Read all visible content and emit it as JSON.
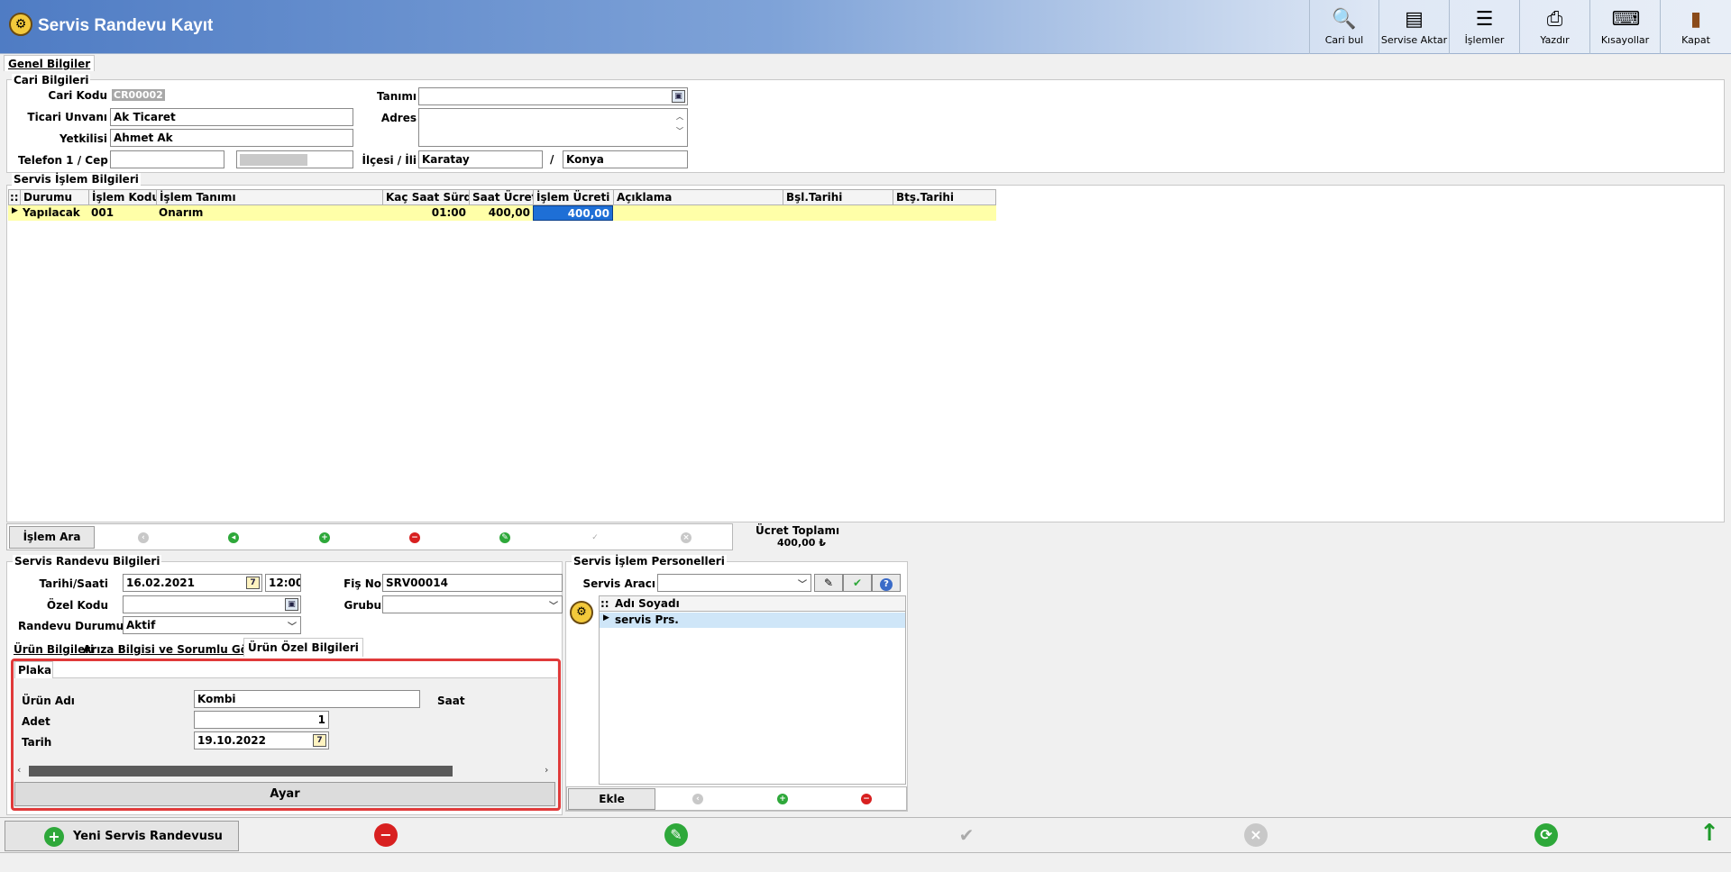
{
  "window": {
    "title": "Servis Randevu Kayıt"
  },
  "toolbar": {
    "buttons": [
      {
        "label": "Cari bul",
        "icon": "user-search-icon"
      },
      {
        "label": "Servise Aktar",
        "icon": "transfer-icon"
      },
      {
        "label": "İşlemler",
        "icon": "list-icon"
      },
      {
        "label": "Yazdır",
        "icon": "printer-icon"
      },
      {
        "label": "Kısayollar",
        "icon": "keyboard-icon"
      },
      {
        "label": "Kapat",
        "icon": "exit-door-icon"
      }
    ]
  },
  "tabs": {
    "main": "Genel Bilgiler"
  },
  "cari": {
    "title": "Cari Bilgileri",
    "cari_kodu_label": "Cari Kodu",
    "cari_kodu": "CR00002",
    "ticari_unvan_label": "Ticari Unvanı",
    "ticari_unvan": "Ak Ticaret",
    "yetkili_label": "Yetkilisi",
    "yetkili": "Ahmet Ak",
    "telefon_label": "Telefon 1 / Cep",
    "telefon": "",
    "cep": "",
    "tanimi_label": "Tanımı",
    "tanimi": "",
    "adres_label": "Adres",
    "adres": "",
    "ilce_label": "İlçesi / İli",
    "ilce": "Karatay",
    "sep": "/",
    "il": "Konya"
  },
  "islem": {
    "title": "Servis İşlem Bilgileri",
    "columns": {
      "handle": "::",
      "durum": "Durumu",
      "kod": "İşlem Kodu",
      "tanim": "İşlem Tanımı",
      "saat": "Kaç Saat Sürdü",
      "saat_ucreti": "Saat Ücreti",
      "islem_ucreti": "İşlem Ücreti",
      "aciklama": "Açıklama",
      "bsl": "Bşl.Tarihi",
      "bts": "Btş.Tarihi"
    },
    "rows": [
      {
        "durum": "Yapılacak",
        "kod": "001",
        "tanim": "Onarım",
        "saat": "01:00",
        "saat_ucreti": "400,00",
        "islem_ucreti": "400,00",
        "aciklama": "",
        "bsl": "",
        "bts": ""
      }
    ],
    "search_button": "İşlem Ara",
    "total_label": "Ücret Toplamı",
    "total_value": "400,00 ₺"
  },
  "randevu": {
    "title": "Servis Randevu Bilgileri",
    "tarih_label": "Tarihi/Saati",
    "tarih": "16.02.2021",
    "saat": "12:00",
    "fis_label": "Fiş No",
    "fis": "SRV00014",
    "ozel_kod_label": "Özel Kodu",
    "ozel_kod": "",
    "grubu_label": "Grubu",
    "grubu": "",
    "durum_label": "Randevu Durumu",
    "durum": "Aktif",
    "tabs": [
      "Ürün Bilgileri",
      "Arıza Bilgisi ve Sorumlu Görüşü",
      "Ürün Özel Bilgileri"
    ],
    "inner_tab": "Plaka",
    "urun_adi_label": "Ürün Adı",
    "urun_adi": "Kombi",
    "saat_label": "Saat",
    "adet_label": "Adet",
    "adet": "1",
    "tarih2_label": "Tarih",
    "tarih2": "19.10.2022",
    "ayar_button": "Ayar"
  },
  "personel": {
    "title": "Servis İşlem Personelleri",
    "arac_label": "Servis Aracı",
    "arac": "",
    "column": "Adı Soyadı",
    "handle": "::",
    "rows": [
      "servis Prs."
    ],
    "ekle_button": "Ekle"
  },
  "footer": {
    "new_button": "Yeni Servis Randevusu"
  },
  "colors": {
    "title_bar_start": "#4f7cc4",
    "title_bar_end": "#e4ecf7",
    "selected_row": "#ffffa8",
    "selected_cell": "#1e6fd6",
    "highlight_border": "#e03a3a"
  }
}
